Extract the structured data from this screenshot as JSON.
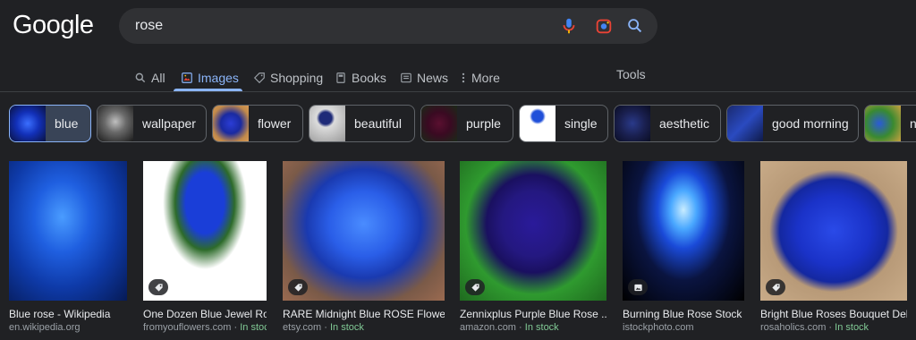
{
  "logo": "Google",
  "search": {
    "query": "rose"
  },
  "tabs": [
    {
      "label": "All",
      "icon": "search-icon"
    },
    {
      "label": "Images",
      "icon": "images-icon"
    },
    {
      "label": "Shopping",
      "icon": "tag-icon"
    },
    {
      "label": "Books",
      "icon": "book-icon"
    },
    {
      "label": "News",
      "icon": "news-icon"
    },
    {
      "label": "More",
      "icon": "more-vert-icon"
    }
  ],
  "tools": "Tools",
  "chips": [
    {
      "label": "blue"
    },
    {
      "label": "wallpaper"
    },
    {
      "label": "flower"
    },
    {
      "label": "beautiful"
    },
    {
      "label": "purple"
    },
    {
      "label": "single"
    },
    {
      "label": "aesthetic"
    },
    {
      "label": "good morning"
    },
    {
      "label": "n"
    }
  ],
  "results": [
    {
      "title": "Blue rose - Wikipedia",
      "source": "en.wikipedia.org",
      "stock": ""
    },
    {
      "title": "One Dozen Blue Jewel Ro...",
      "source": "fromyouflowers.com",
      "stock": "In stock"
    },
    {
      "title": "RARE Midnight Blue ROSE Flower ...",
      "source": "etsy.com",
      "stock": "In stock"
    },
    {
      "title": "Zennixplus Purple Blue Rose ...",
      "source": "amazon.com",
      "stock": "In stock"
    },
    {
      "title": "Burning Blue Rose Stock ...",
      "source": "istockphoto.com",
      "stock": ""
    },
    {
      "title": "Bright Blue Roses Bouquet Deli...",
      "source": "rosaholics.com",
      "stock": "In stock"
    }
  ],
  "separator": "·",
  "colors": {
    "accent": "#8ab4f8",
    "background": "#202124",
    "stock": "#81c995"
  }
}
